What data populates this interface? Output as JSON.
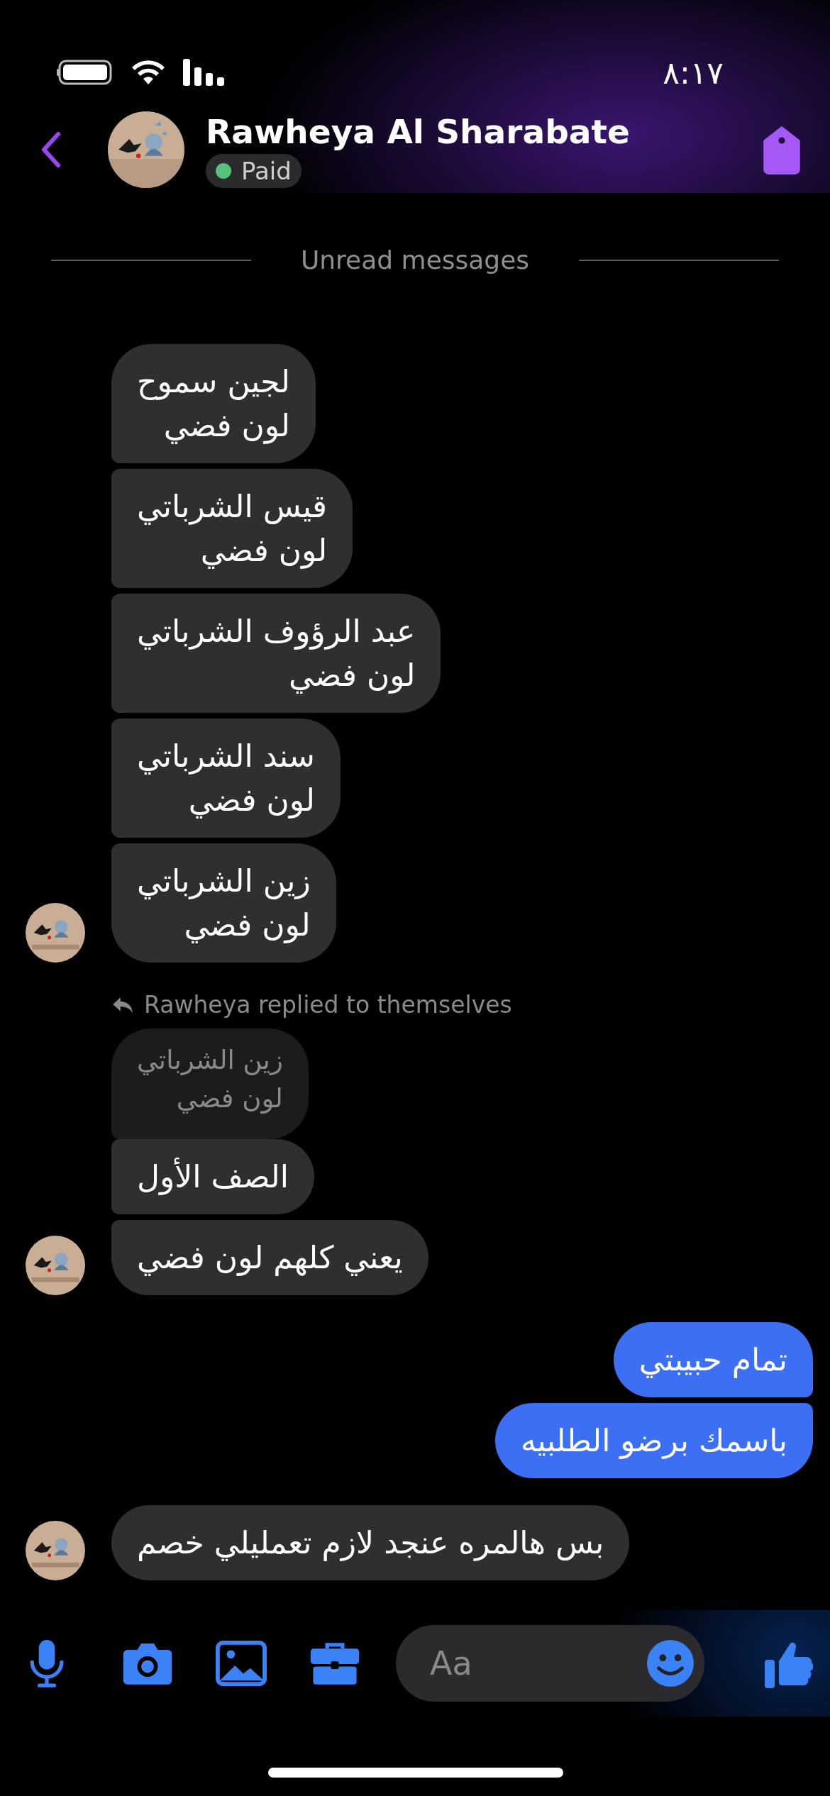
{
  "status_bar": {
    "time": "٨:١٧"
  },
  "header": {
    "name": "Rawheya Al Sharabate",
    "badge": "Paid"
  },
  "divider": {
    "label": "Unread messages"
  },
  "messages": [
    {
      "kind": "incoming",
      "text": "لجين سموح\nلون فضي",
      "avatar": false
    },
    {
      "kind": "incoming",
      "text": "قيس الشرباتي\nلون فضي",
      "avatar": false
    },
    {
      "kind": "incoming",
      "text": "عبد الرؤوف الشرباتي\nلون فضي",
      "avatar": false
    },
    {
      "kind": "incoming",
      "text": "سند الشرباتي\nلون فضي",
      "avatar": false
    },
    {
      "kind": "incoming",
      "text": "زين الشرباتي\nلون فضي",
      "avatar": true
    },
    {
      "kind": "reply_note",
      "text": "Rawheya replied to themselves"
    },
    {
      "kind": "quoted",
      "text": "زين الشرباتي\nلون فضي"
    },
    {
      "kind": "incoming",
      "text": "الصف الأول",
      "avatar": false
    },
    {
      "kind": "incoming",
      "text": "يعني كلهم لون فضي",
      "avatar": true
    },
    {
      "kind": "outgoing",
      "text": "تمام حبيبتي"
    },
    {
      "kind": "outgoing",
      "text": "باسمك برضو الطلبيه"
    },
    {
      "kind": "incoming",
      "text": "بس هالمره عنجد لازم تعمليلي خصم",
      "avatar": true
    }
  ],
  "composer": {
    "placeholder": "Aa"
  }
}
